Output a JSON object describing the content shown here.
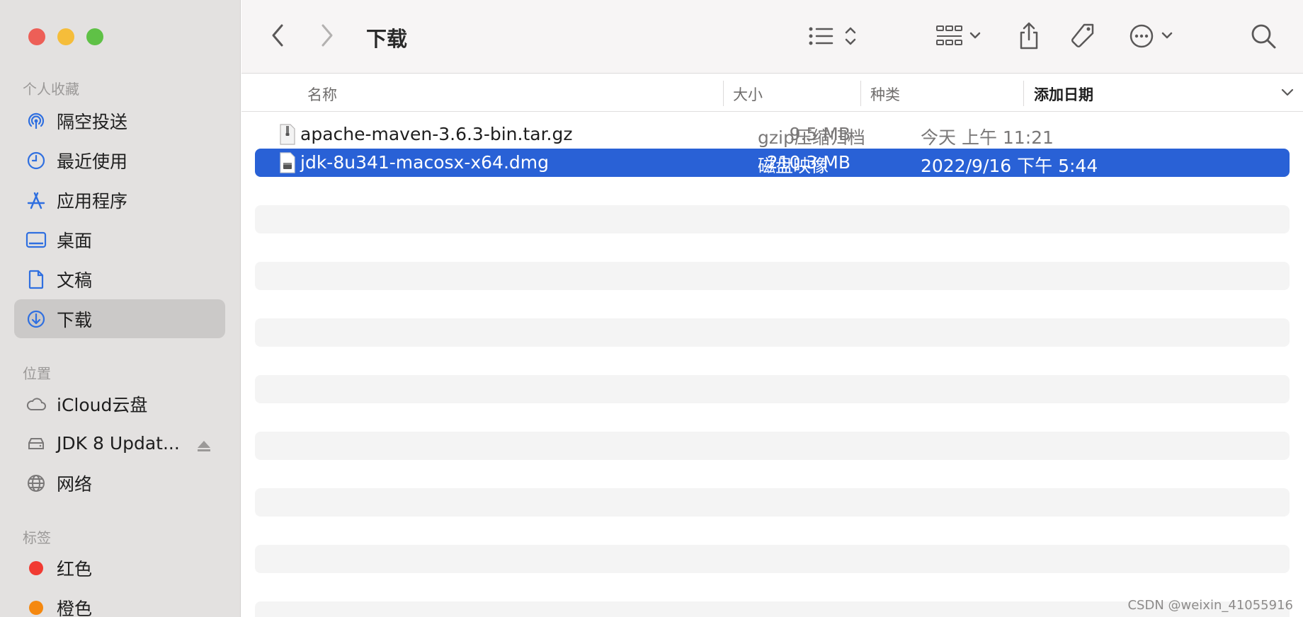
{
  "sidebar": {
    "favorites_title": "个人收藏",
    "favorites": [
      {
        "label": "隔空投送",
        "icon": "airdrop-icon"
      },
      {
        "label": "最近使用",
        "icon": "clock-icon"
      },
      {
        "label": "应用程序",
        "icon": "applications-icon"
      },
      {
        "label": "桌面",
        "icon": "desktop-icon"
      },
      {
        "label": "文稿",
        "icon": "document-icon"
      },
      {
        "label": "下载",
        "icon": "download-icon",
        "selected": true
      }
    ],
    "locations_title": "位置",
    "locations": [
      {
        "label": "iCloud云盘",
        "icon": "cloud-icon"
      },
      {
        "label": "JDK 8 Updat...",
        "icon": "disk-icon"
      },
      {
        "label": "网络",
        "icon": "network-icon"
      }
    ],
    "tags_title": "标签",
    "tags": [
      {
        "label": "红色",
        "color": "#f13a32"
      },
      {
        "label": "橙色",
        "color": "#f5880f"
      }
    ]
  },
  "toolbar": {
    "title": "下载"
  },
  "columns": {
    "name": "名称",
    "size": "大小",
    "kind": "种类",
    "date": "添加日期"
  },
  "files": [
    {
      "name": "apache-maven-3.6.3-bin.tar.gz",
      "size": "9.5 MB",
      "kind": "gzip压缩归档",
      "date": "今天 上午 11:21",
      "icon": "archive-icon"
    },
    {
      "name": "jdk-8u341-macosx-x64.dmg",
      "size": "210.3 MB",
      "kind": "磁盘映像",
      "date": "2022/9/16 下午 5:44",
      "icon": "disk-image-icon",
      "selected": true
    }
  ],
  "watermark": "CSDN @weixin_41055916",
  "colors": {
    "selection": "#2961d6",
    "accent_icon": "#2f6fe0",
    "close": "#ed5f57",
    "minimize": "#f5bd3a",
    "zoom": "#5fc146"
  }
}
